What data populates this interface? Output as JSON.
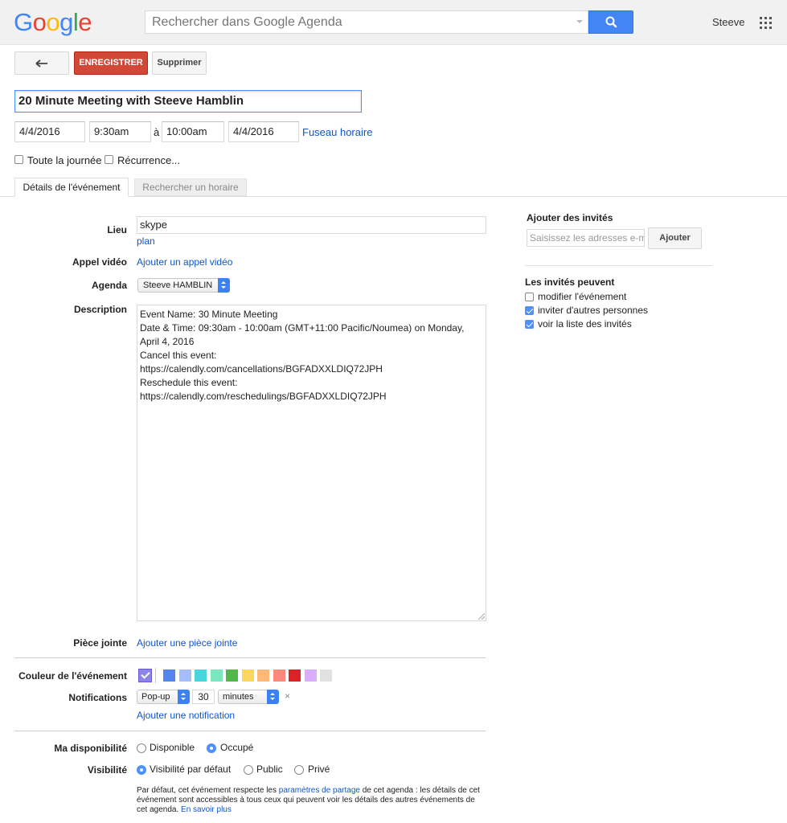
{
  "header": {
    "logo": "Google",
    "search_placeholder": "Rechercher dans Google Agenda",
    "user_name": "Steeve"
  },
  "toolbar": {
    "back_label": "↞",
    "save_label": "ENREGISTRER",
    "delete_label": "Supprimer"
  },
  "event": {
    "title": "20 Minute Meeting with Steeve Hamblin",
    "start_date": "4/4/2016",
    "start_time": "9:30am",
    "to_label": "à",
    "end_time": "10:00am",
    "end_date": "4/4/2016",
    "timezone_link": "Fuseau horaire",
    "all_day_label": "Toute la journée",
    "recurrence_label": "Récurrence..."
  },
  "tabs": {
    "details": "Détails de l'événement",
    "find_time": "Rechercher un horaire"
  },
  "form": {
    "location_label": "Lieu",
    "location_value": "skype",
    "map_link": "plan",
    "video_label": "Appel vidéo",
    "video_link": "Ajouter un appel vidéo",
    "calendar_label": "Agenda",
    "calendar_value": "Steeve HAMBLIN",
    "description_label": "Description",
    "description_lines": [
      "Event Name: 30 Minute Meeting",
      "Date & Time: 09:30am - 10:00am (GMT+11:00 Pacific/Noumea) on Monday,",
      "April 4, 2016",
      "",
      "Cancel this event:",
      "https://calendly.com/cancellations/BGFADXXLDIQ72JPH",
      "Reschedule this event:",
      "https://calendly.com/reschedulings/BGFADXXLDIQ72JPH"
    ],
    "attachment_label": "Pièce jointe",
    "attachment_link": "Ajouter une pièce jointe",
    "color_label": "Couleur de l'événement",
    "colors": [
      "#5484ed",
      "#a4bdfc",
      "#46d6db",
      "#7ae7bf",
      "#51b749",
      "#fbd75b",
      "#ffb878",
      "#ff887c",
      "#dc2127",
      "#dbadff",
      "#e1e1e1"
    ],
    "selected_color": "#8d84e8",
    "notifications_label": "Notifications",
    "notif_type": "Pop-up",
    "notif_value": "30",
    "notif_unit": "minutes",
    "notif_remove": "×",
    "add_notification_link": "Ajouter une notification",
    "availability_label": "Ma disponibilité",
    "availability_free": "Disponible",
    "availability_busy": "Occupé",
    "visibility_label": "Visibilité",
    "visibility_default": "Visibilité par défaut",
    "visibility_public": "Public",
    "visibility_private": "Privé",
    "visibility_note_1": "Par défaut, cet événement respecte les ",
    "visibility_note_link": "paramètres de partage",
    "visibility_note_2": " de cet agenda : les détails de cet événement sont accessibles à tous ceux qui peuvent voir les détails des autres événements de cet agenda.  ",
    "learn_more_link": "En savoir plus"
  },
  "guests": {
    "title": "Ajouter des invités",
    "input_placeholder": "Saisissez les adresses e-mail",
    "add_button": "Ajouter",
    "permissions_title": "Les invités peuvent",
    "perm_modify": "modifier l'événement",
    "perm_invite": "inviter d'autres personnes",
    "perm_see_list": "voir la liste des invités"
  }
}
